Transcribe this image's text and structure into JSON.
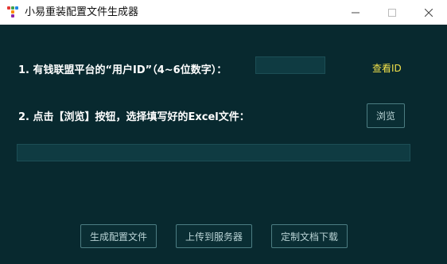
{
  "window": {
    "title": "小易重装配置文件生成器",
    "app_icon": "app-icon",
    "controls": {
      "minimize": "minimize-icon",
      "maximize": "maximize-icon",
      "close": "close-icon"
    }
  },
  "colors": {
    "background": "#08292f",
    "link": "#f2e14a",
    "title_bar": "#ffffff"
  },
  "step1": {
    "label": "1. 有钱联盟平台的“用户ID”（4~6位数字）：",
    "input_value": "",
    "link": "查看ID"
  },
  "step2": {
    "label": "2. 点击【浏览】按钮，选择填写好的Excel文件：",
    "browse_button": "浏览",
    "path_value": ""
  },
  "actions": {
    "generate": "生成配置文件",
    "upload": "上传到服务器",
    "custom_download": "定制文档下载"
  }
}
